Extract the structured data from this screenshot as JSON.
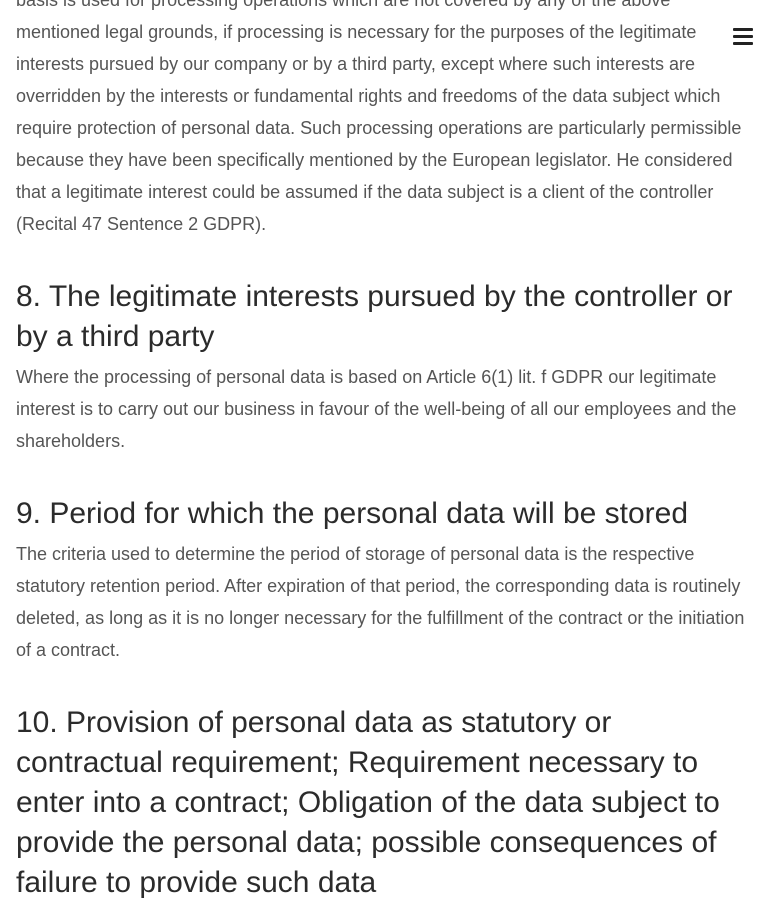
{
  "intro_paragraph": "basis is used for processing operations which are not covered by any of the above mentioned legal grounds, if processing is necessary for the purposes of the legitimate interests pursued by our company or by a third party, except where such interests are overridden by the interests or fundamental rights and freedoms of the data subject which require protection of personal data. Such processing operations are particularly permissible because they have been specifically mentioned by the European legislator. He considered that a legitimate interest could be assumed if the data subject is a client of the controller (Recital 47 Sentence 2 GDPR).",
  "sections": [
    {
      "heading": "8. The legitimate interests pursued by the controller or by a third party",
      "body": "Where the processing of personal data is based on Article 6(1) lit. f GDPR our legitimate interest is to carry out our business in favour of the well-being of all our employees and the shareholders."
    },
    {
      "heading": "9. Period for which the personal data will be stored",
      "body": "The criteria used to determine the period of storage of personal data is the respective statutory retention period. After expiration of that period, the corresponding data is routinely deleted, as long as it is no longer necessary for the fulfillment of the contract or the initiation of a contract."
    },
    {
      "heading": "10. Provision of personal data as statutory or contractual requirement; Requirement necessary to enter into a contract; Obligation of the data subject to provide the personal data; possible consequences of failure to provide such data"
    }
  ],
  "menu": {
    "icon": "hamburger-menu-icon"
  }
}
